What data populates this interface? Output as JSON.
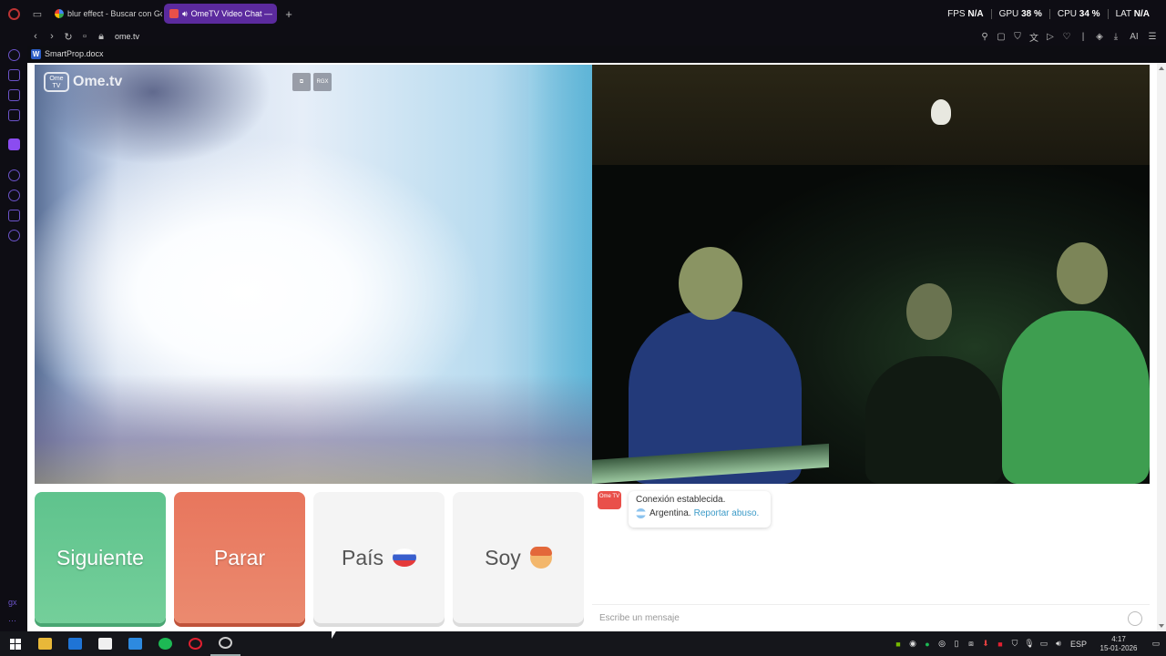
{
  "browser": {
    "tabs": [
      {
        "title": "blur effect - Buscar con Go",
        "active": false
      },
      {
        "title": "OmeTV Video Chat —",
        "active": true
      }
    ],
    "new_tab_label": "+",
    "perf": {
      "fps_label": "FPS",
      "fps_value": "N/A",
      "gpu_label": "GPU",
      "gpu_value": "38 %",
      "cpu_label": "CPU",
      "cpu_value": "34 %",
      "lat_label": "LAT",
      "lat_value": "N/A"
    },
    "url": "ome.tv",
    "bookmark": "SmartProp.docx",
    "ai_label": "AI"
  },
  "video": {
    "logo_tv": "Ome TV",
    "logo_text": "Ome.tv",
    "btn_rgx": "RGX"
  },
  "controls": {
    "next": "Siguiente",
    "stop": "Parar",
    "country": "País",
    "gender": "Soy"
  },
  "chat": {
    "logo": "Ome TV",
    "status": "Conexión establecida.",
    "country": "Argentina.",
    "report": "Reportar abuso.",
    "placeholder": "Escribe un mensaje"
  },
  "taskbar": {
    "lang": "ESP",
    "time": "4:17",
    "date": "15-01-2026"
  },
  "colors": {
    "next": "#5fc38d",
    "stop": "#e8765d",
    "active_tab": "#5b2a9e",
    "link": "#3c9bc8"
  }
}
